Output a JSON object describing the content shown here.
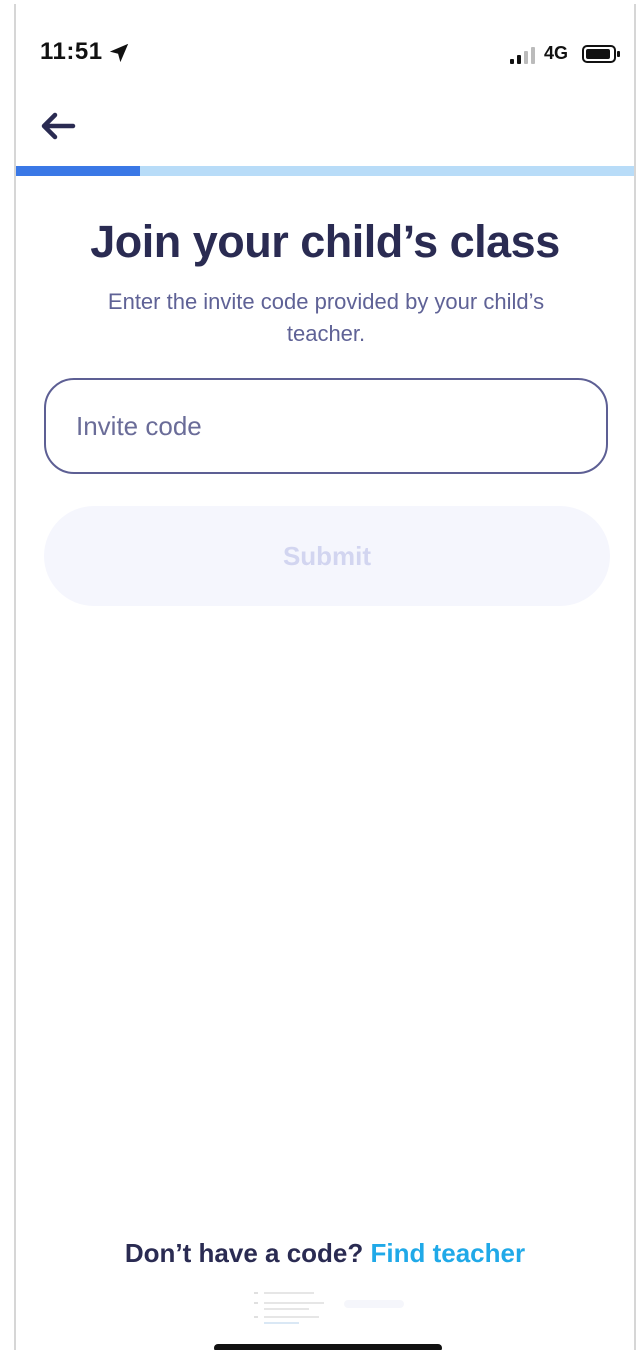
{
  "status_bar": {
    "time": "11:51",
    "network": "4G"
  },
  "progress": {
    "percent": 20,
    "fill_color": "#3a78e6",
    "track_color": "#b8dcf8"
  },
  "header": {
    "title": "Join your child’s class",
    "subtitle": "Enter the invite code provided by your child’s teacher."
  },
  "form": {
    "invite_placeholder": "Invite code",
    "invite_value": "",
    "submit_label": "Submit"
  },
  "footer": {
    "prompt": "Don’t have a code?",
    "link_label": "Find teacher"
  },
  "colors": {
    "title": "#2a2b52",
    "subtitle": "#5f6296",
    "link": "#20a9e8",
    "submit_disabled_bg": "#f5f6fd",
    "submit_disabled_text": "#d2d5f0"
  },
  "icons": {
    "back": "arrow-left-icon",
    "location": "location-arrow-icon",
    "signal": "signal-bars-icon",
    "battery": "battery-icon"
  }
}
